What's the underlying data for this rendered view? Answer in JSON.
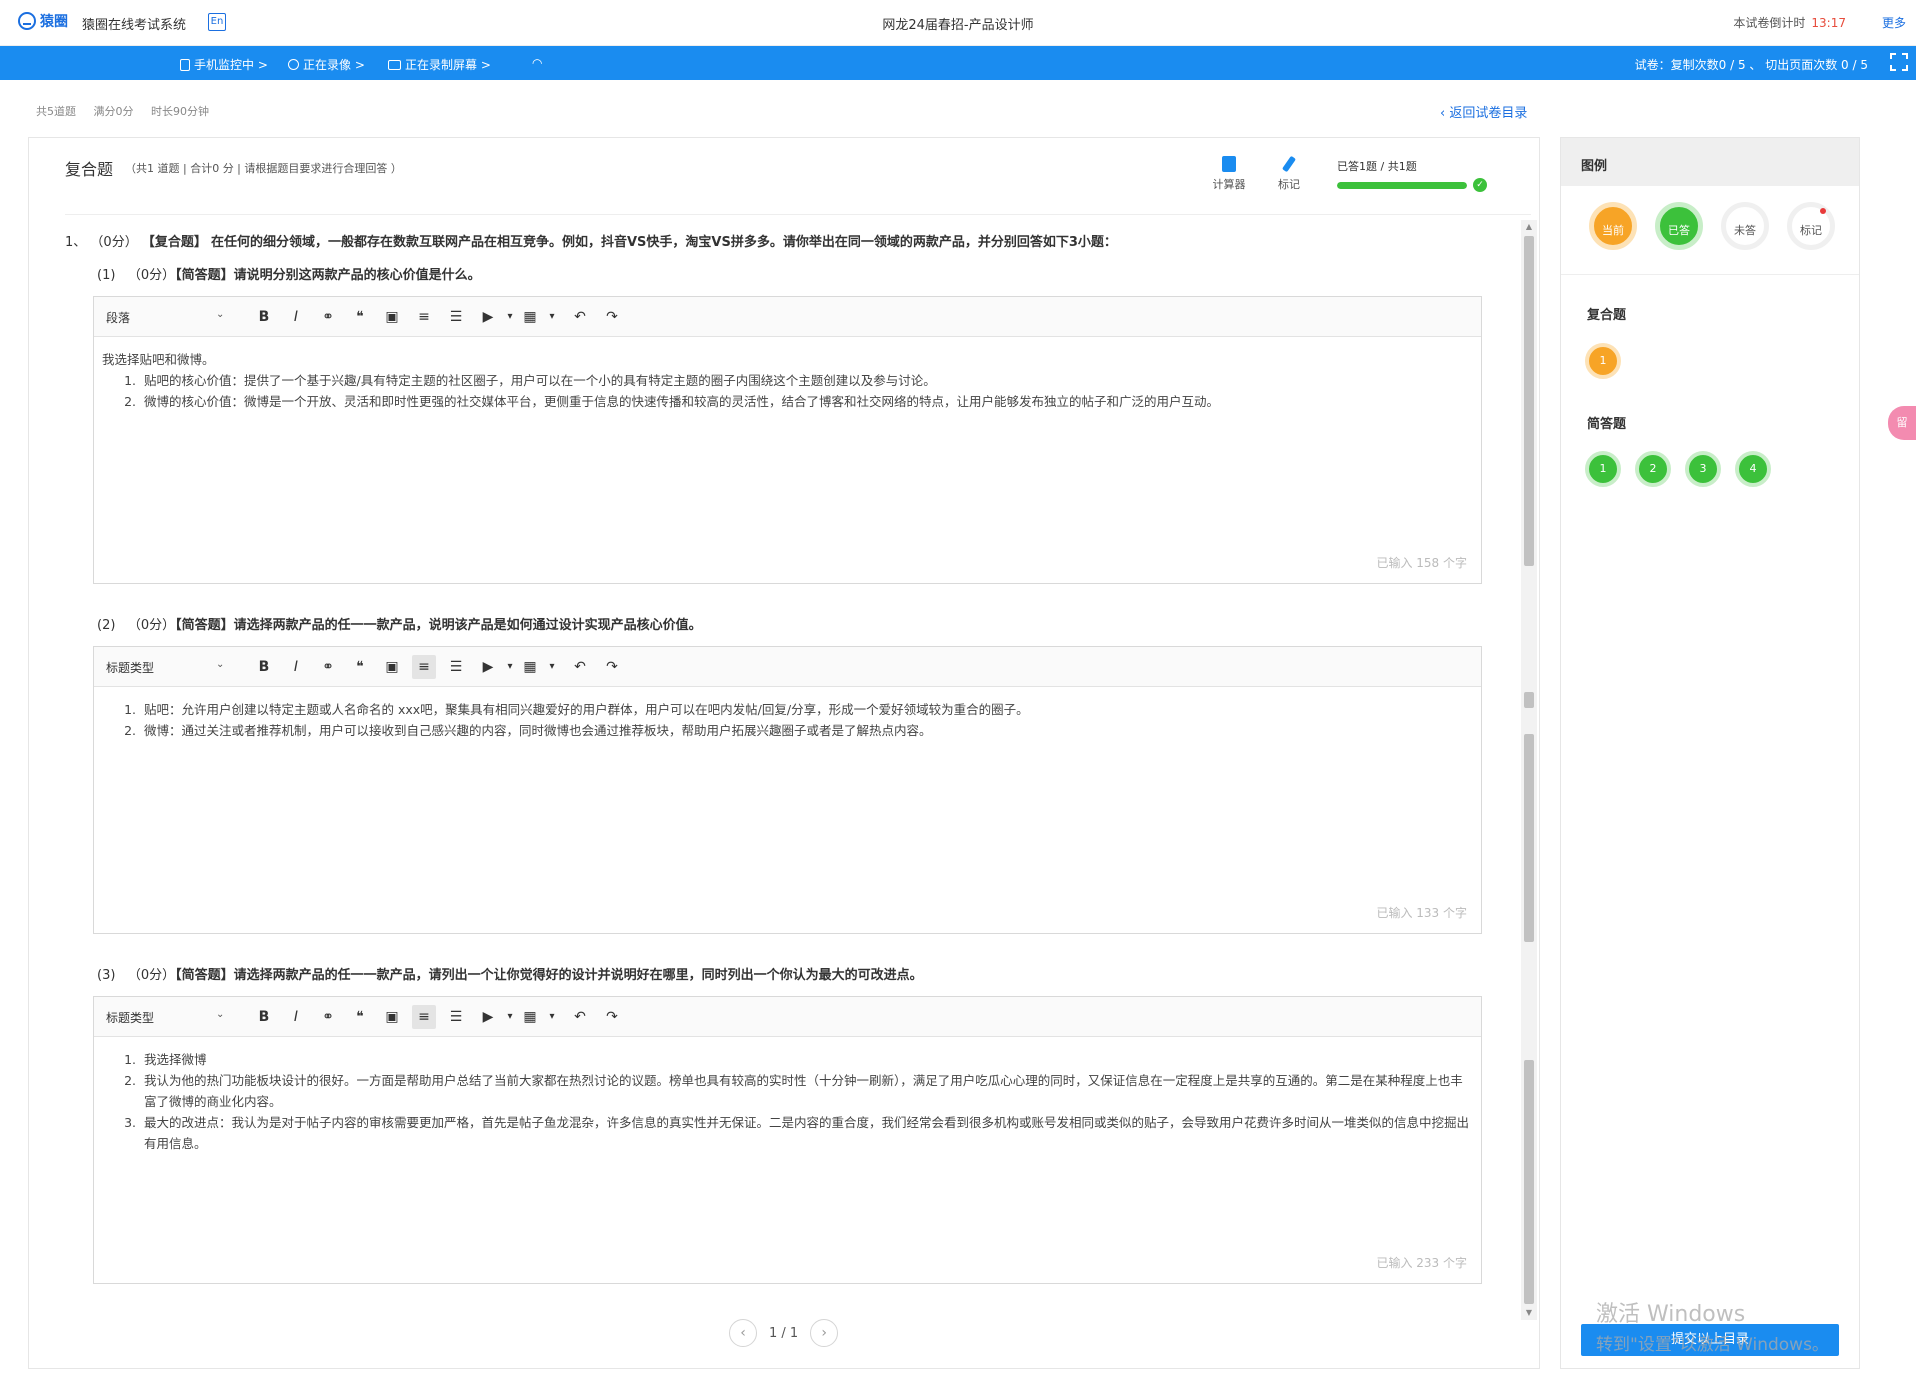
{
  "topbar": {
    "brand": "猿圈",
    "system_name": "猿圈在线考试系统",
    "lang_badge": "En",
    "exam_title": "网龙24届春招-产品设计师",
    "countdown_label": "本试卷倒计时",
    "countdown_time": "13:17",
    "more": "更多"
  },
  "monitorbar": {
    "phone": "手机监控中 >",
    "camera": "正在录像 >",
    "screen": "正在录制屏幕 >",
    "right_info": "试卷：复制次数0 / 5 、 切出页面次数 0 / 5"
  },
  "meta": {
    "total": "共5道题",
    "score": "满分0分",
    "duration": "时长90分钟",
    "back": "返回试卷目录"
  },
  "section": {
    "title": "复合题",
    "desc": "（共1 道题 | 合计0 分 | 请根据题目要求进行合理回答 ）",
    "calc": "计算器",
    "mark": "标记",
    "progress_text": "已答1题 / 共1题",
    "progress_fraction": 1.0
  },
  "main_question": {
    "num": "1、",
    "score": "（0分）",
    "type": "【复合题】",
    "text": "在任何的细分领域，一般都存在数款互联网产品在相互竞争。例如，抖音VS快手，淘宝VS拼多多。请你举出在同一领域的两款产品，并分别回答如下3小题："
  },
  "subquestions": [
    {
      "num": "(1)",
      "score": "（0分）",
      "type": "【简答题】",
      "text": "请说明分别这两款产品的核心价值是什么。",
      "toolbar_select": "段落",
      "intro": "我选择贴吧和微博。",
      "items": [
        "贴吧的核心价值：提供了一个基于兴趣/具有特定主题的社区圈子，用户可以在一个小的具有特定主题的圈子内围绕这个主题创建以及参与讨论。",
        "微博的核心价值：微博是一个开放、灵活和即时性更强的社交媒体平台，更侧重于信息的快速传播和较高的灵活性，结合了博客和社交网络的特点，让用户能够发布独立的帖子和广泛的用户互动。"
      ],
      "counter": "已输入 158 个字"
    },
    {
      "num": "(2)",
      "score": "（0分）",
      "type": "【简答题】",
      "text": "请选择两款产品的任一一款产品，说明该产品是如何通过设计实现产品核心价值。",
      "toolbar_select": "标题类型",
      "intro": "",
      "items": [
        "贴吧：允许用户创建以特定主题或人名命名的 xxx吧，聚集具有相同兴趣爱好的用户群体，用户可以在吧内发帖/回复/分享，形成一个爱好领域较为重合的圈子。",
        "微博：通过关注或者推荐机制，用户可以接收到自己感兴趣的内容，同时微博也会通过推荐板块，帮助用户拓展兴趣圈子或者是了解热点内容。"
      ],
      "counter": "已输入 133 个字"
    },
    {
      "num": "(3)",
      "score": "（0分）",
      "type": "【简答题】",
      "text": "请选择两款产品的任一一款产品，请列出一个让你觉得好的设计并说明好在哪里，同时列出一个你认为最大的可改进点。",
      "toolbar_select": "标题类型",
      "intro": "",
      "items": [
        "我选择微博",
        "我认为他的热门功能板块设计的很好。一方面是帮助用户总结了当前大家都在热烈讨论的议题。榜单也具有较高的实时性（十分钟一刷新），满足了用户吃瓜心心理的同时，又保证信息在一定程度上是共享的互通的。第二是在某种程度上也丰富了微博的商业化内容。",
        "最大的改进点：我认为是对于帖子内容的审核需要更加严格，首先是帖子鱼龙混杂，许多信息的真实性并无保证。二是内容的重合度，我们经常会看到很多机构或账号发相同或类似的贴子，会导致用户花费许多时间从一堆类似的信息中挖掘出有用信息。"
      ],
      "counter": "已输入 233 个字"
    }
  ],
  "pager": {
    "prev": "‹",
    "text": "1 / 1",
    "next": "›"
  },
  "sidebar": {
    "legend_title": "图例",
    "legend": [
      "当前",
      "已答",
      "未答",
      "标记"
    ],
    "group1_title": "复合题",
    "group1": [
      "1"
    ],
    "group2_title": "简答题",
    "group2": [
      "1",
      "2",
      "3",
      "4"
    ],
    "submit": "提交以上目录",
    "side_tab": "留"
  },
  "watermark": {
    "line1": "激活 Windows",
    "line2": "转到\"设置\"以激活 Windows。"
  },
  "colors": {
    "primary": "#1a8cf0",
    "current": "#f7a426",
    "answered": "#3cc13b",
    "countdown": "#e74c3c"
  }
}
